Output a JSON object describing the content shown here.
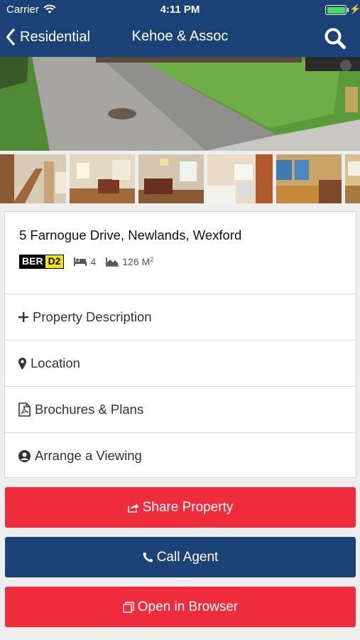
{
  "status_bar": {
    "carrier": "Carrier",
    "time": "4:11 PM",
    "battery_level": 1.0,
    "battery_color": "#4cd964"
  },
  "nav": {
    "back_label": "Residential",
    "title": "Kehoe & Assoc",
    "back_icon": "chevron-left-icon",
    "search_icon": "search-icon"
  },
  "property": {
    "address": "5 Farnogue Drive, Newlands, Wexford",
    "ber_label": "BER",
    "ber_rating": "D2",
    "bedrooms": "4",
    "area_value": "126 M",
    "area_unit_exp": "2"
  },
  "sections": [
    {
      "label": "Property Description",
      "icon": "plus-icon"
    },
    {
      "label": "Location",
      "icon": "map-marker-icon"
    },
    {
      "label": "Brochures & Plans",
      "icon": "pdf-file-icon"
    },
    {
      "label": "Arrange a Viewing",
      "icon": "user-circle-icon"
    }
  ],
  "actions": {
    "share": "Share Property",
    "call": "Call Agent",
    "browser": "Open in Browser"
  },
  "colors": {
    "brand_blue": "#1b4276",
    "action_red": "#ee2c3c",
    "ber_yellow": "#f5e600"
  }
}
